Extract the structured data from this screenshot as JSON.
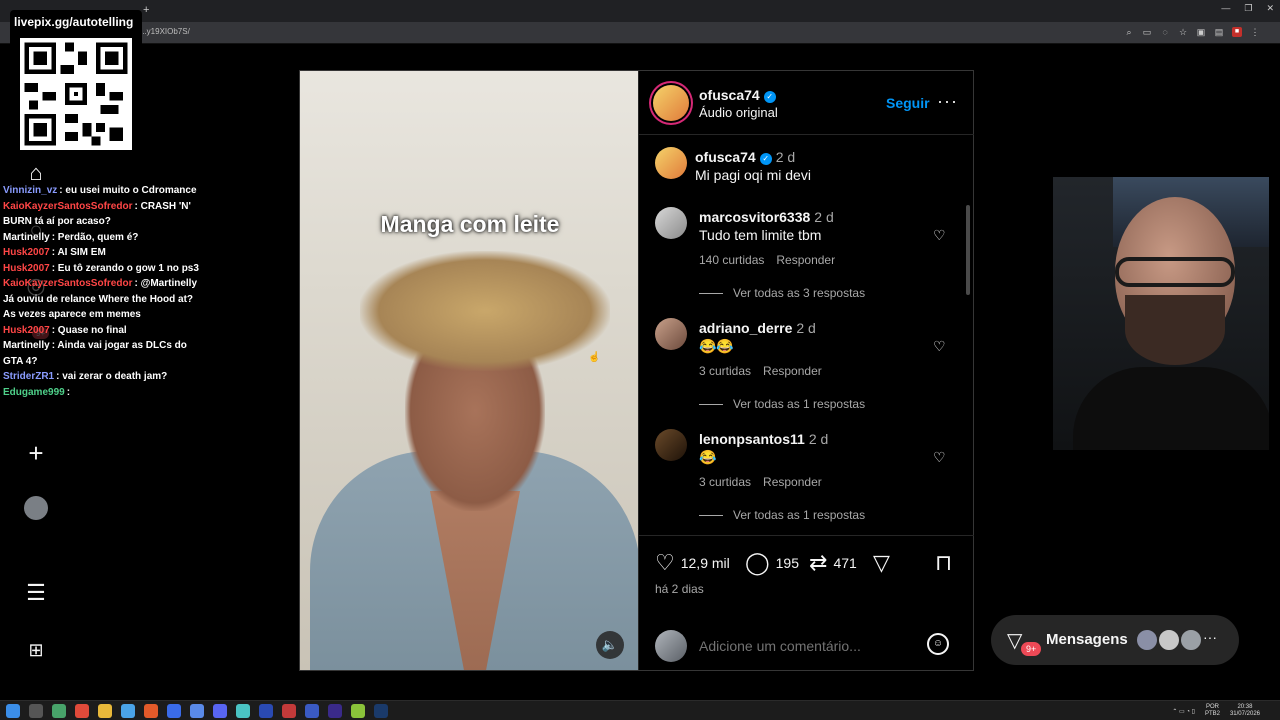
{
  "browser": {
    "url": "...y19XIOb7S/",
    "tab_plus": "+"
  },
  "overlay": {
    "qr_label": "livepix.gg/autotelling",
    "chat": [
      {
        "user": "Vinnizin_vz",
        "color": "#8a9cff",
        "text": ": eu usei muito o Cdromance"
      },
      {
        "user": "KaioKayzerSantosSofredor",
        "color": "#ff4646",
        "text": ": CRASH 'N' BURN tá aí por acaso?"
      },
      {
        "user": "Martinelly",
        "color": "#ffffff",
        "text": ": Perdão, quem é?"
      },
      {
        "user": "Husk2007",
        "color": "#ff4646",
        "text": ": AI SIM EM"
      },
      {
        "user": "Husk2007",
        "color": "#ff4646",
        "text": ": Eu tô zerando o gow 1 no ps3"
      },
      {
        "user": "KaioKayzerSantosSofredor",
        "color": "#ff4646",
        "text": ": @Martinelly Já ouviu de relance Where the Hood at? As vezes aparece em memes"
      },
      {
        "user": "Husk2007",
        "color": "#ff4646",
        "text": ": Quase no final"
      },
      {
        "user": "Martinelly",
        "color": "#ffffff",
        "text": ": Ainda vai jogar as DLCs do GTA 4?"
      },
      {
        "user": "StriderZR1",
        "color": "#8a9cff",
        "text": ": vai zerar o death jam?"
      },
      {
        "user": "Edugame999",
        "color": "#4fd18a",
        "text": ": "
      }
    ]
  },
  "nav": {
    "badge": "9+",
    "icons": [
      "home-icon",
      "search-icon",
      "explore-icon",
      "reels-icon",
      "messages-icon",
      "notifications-icon",
      "create-icon",
      "profile-avatar",
      "menu-icon",
      "more-apps-icon"
    ]
  },
  "post": {
    "caption": "Manga com leite",
    "author": "ofusca74",
    "audio": "Áudio original",
    "follow": "Seguir",
    "more": "···",
    "description": {
      "user": "ofusca74",
      "time": "2 d",
      "text": "Mi pagi oqi mi devi"
    },
    "comments": [
      {
        "user": "marcosvitor6338",
        "time": "2 d",
        "text": "Tudo tem limite tbm",
        "likes": "140 curtidas",
        "reply": "Responder",
        "view": "Ver todas as 3 respostas"
      },
      {
        "user": "adriano_derre",
        "time": "2 d",
        "text": "😂😂",
        "likes": "3 curtidas",
        "reply": "Responder",
        "view": "Ver todas as 1 respostas"
      },
      {
        "user": "lenonpsantos11",
        "time": "2 d",
        "text": "😂",
        "likes": "3 curtidas",
        "reply": "Responder",
        "view": "Ver todas as 1 respostas"
      }
    ],
    "stats": {
      "likes": "12,9 mil",
      "comments": "195",
      "reposts": "471"
    },
    "ago": "há 2 dias",
    "add_comment_placeholder": "Adicione um comentário..."
  },
  "messages": {
    "label": "Mensagens",
    "badge": "9+",
    "more": "···"
  },
  "taskbar": {
    "lang": "POR",
    "lang2": "PTB2",
    "time": "20:38",
    "date": "31/07/2026"
  },
  "colors": {
    "accent": "#0095f6",
    "badge": "#ed4956",
    "bg": "#000000"
  }
}
